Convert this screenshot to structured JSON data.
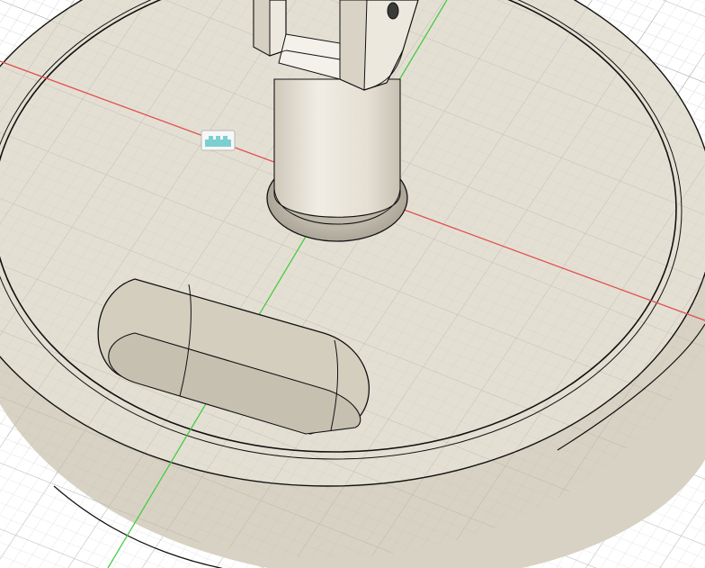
{
  "viewport": {
    "background": "#ffffff",
    "model_color": "#e6e1d6",
    "model_dark": "#d2ccbe",
    "edge_color": "#111111",
    "grid_color": "#8c8c8c",
    "x_axis_color": "#e05050",
    "y_axis_color": "#44cc44"
  },
  "comment_marker": {
    "icon": "comment-pin-icon",
    "color": "#7ccfcf"
  }
}
